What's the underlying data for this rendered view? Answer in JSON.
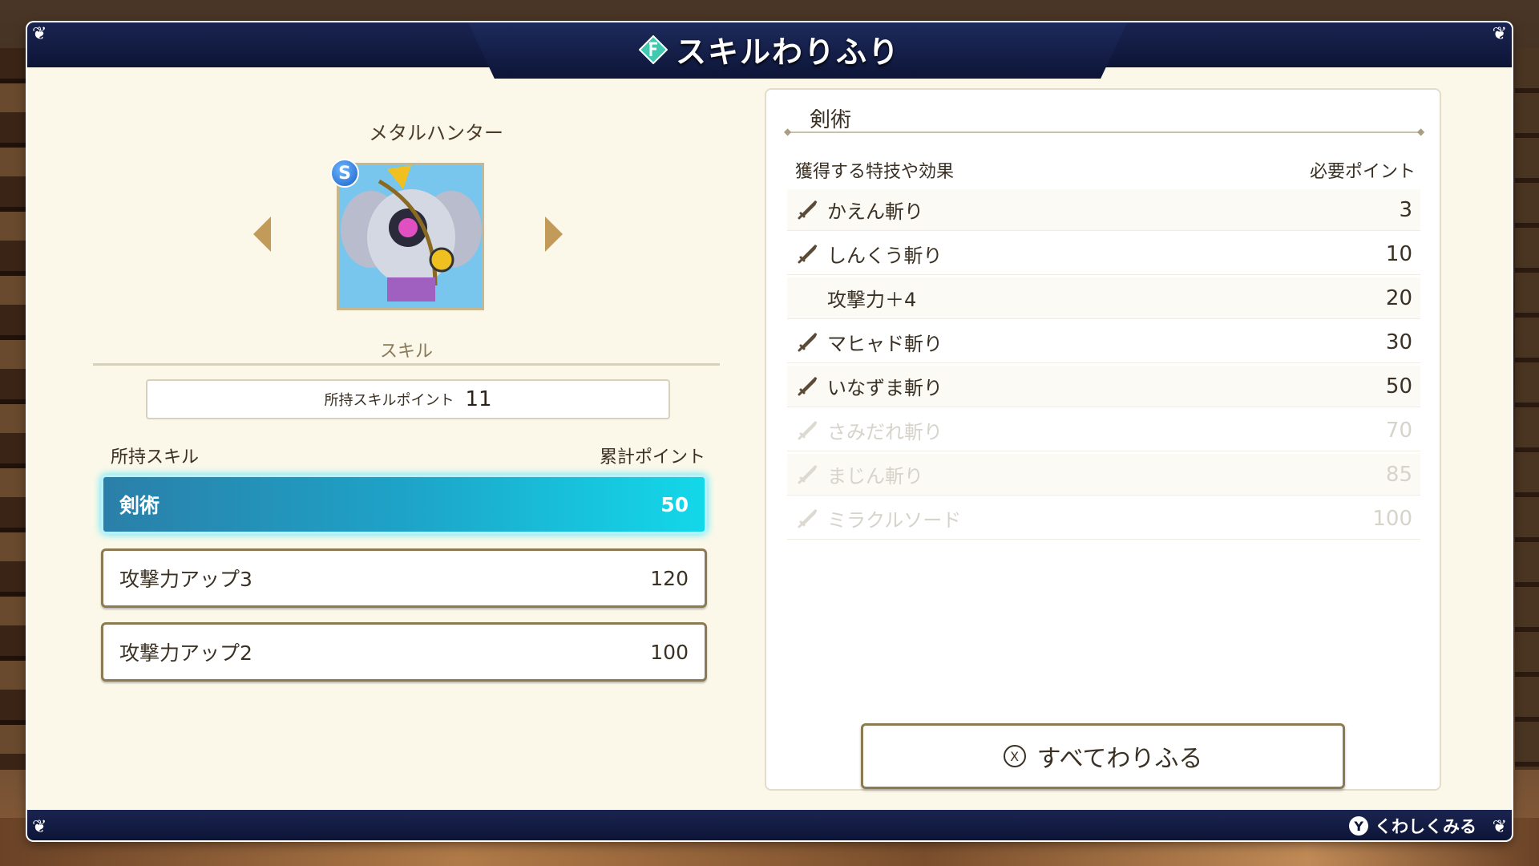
{
  "header": {
    "title": "スキルわりふり"
  },
  "character": {
    "name": "メタルハンター",
    "rank_badge": "S"
  },
  "skill_section": {
    "label": "スキル",
    "points_label": "所持スキルポイント",
    "points_value": "11",
    "owned_label": "所持スキル",
    "total_label": "累計ポイント",
    "skills": [
      {
        "name": "剣術",
        "points": "50"
      },
      {
        "name": "攻撃力アップ3",
        "points": "120"
      },
      {
        "name": "攻撃力アップ2",
        "points": "100"
      }
    ]
  },
  "detail": {
    "title": "剣術",
    "col_effect": "獲得する特技や効果",
    "col_points": "必要ポイント",
    "abilities": [
      {
        "name": "かえん斬り",
        "points": "3",
        "icon": "sword-icon",
        "locked": false
      },
      {
        "name": "しんくう斬り",
        "points": "10",
        "icon": "sword-icon",
        "locked": false
      },
      {
        "name": "攻撃力＋4",
        "points": "20",
        "icon": "",
        "locked": false
      },
      {
        "name": "マヒャド斬り",
        "points": "30",
        "icon": "sword-icon",
        "locked": false
      },
      {
        "name": "いなずま斬り",
        "points": "50",
        "icon": "sword-icon",
        "locked": false
      },
      {
        "name": "さみだれ斬り",
        "points": "70",
        "icon": "sword-icon",
        "locked": true
      },
      {
        "name": "まじん斬り",
        "points": "85",
        "icon": "sword-icon",
        "locked": true
      },
      {
        "name": "ミラクルソード",
        "points": "100",
        "icon": "sword-icon",
        "locked": true
      }
    ],
    "assign_all_label": "すべてわりふる",
    "assign_all_button_glyph": "X"
  },
  "footer": {
    "hint_button": "Y",
    "hint_label": "くわしくみる"
  },
  "colors": {
    "accent": "#13d8ea",
    "frame": "#0d1537",
    "panel": "#fbf8e9"
  }
}
